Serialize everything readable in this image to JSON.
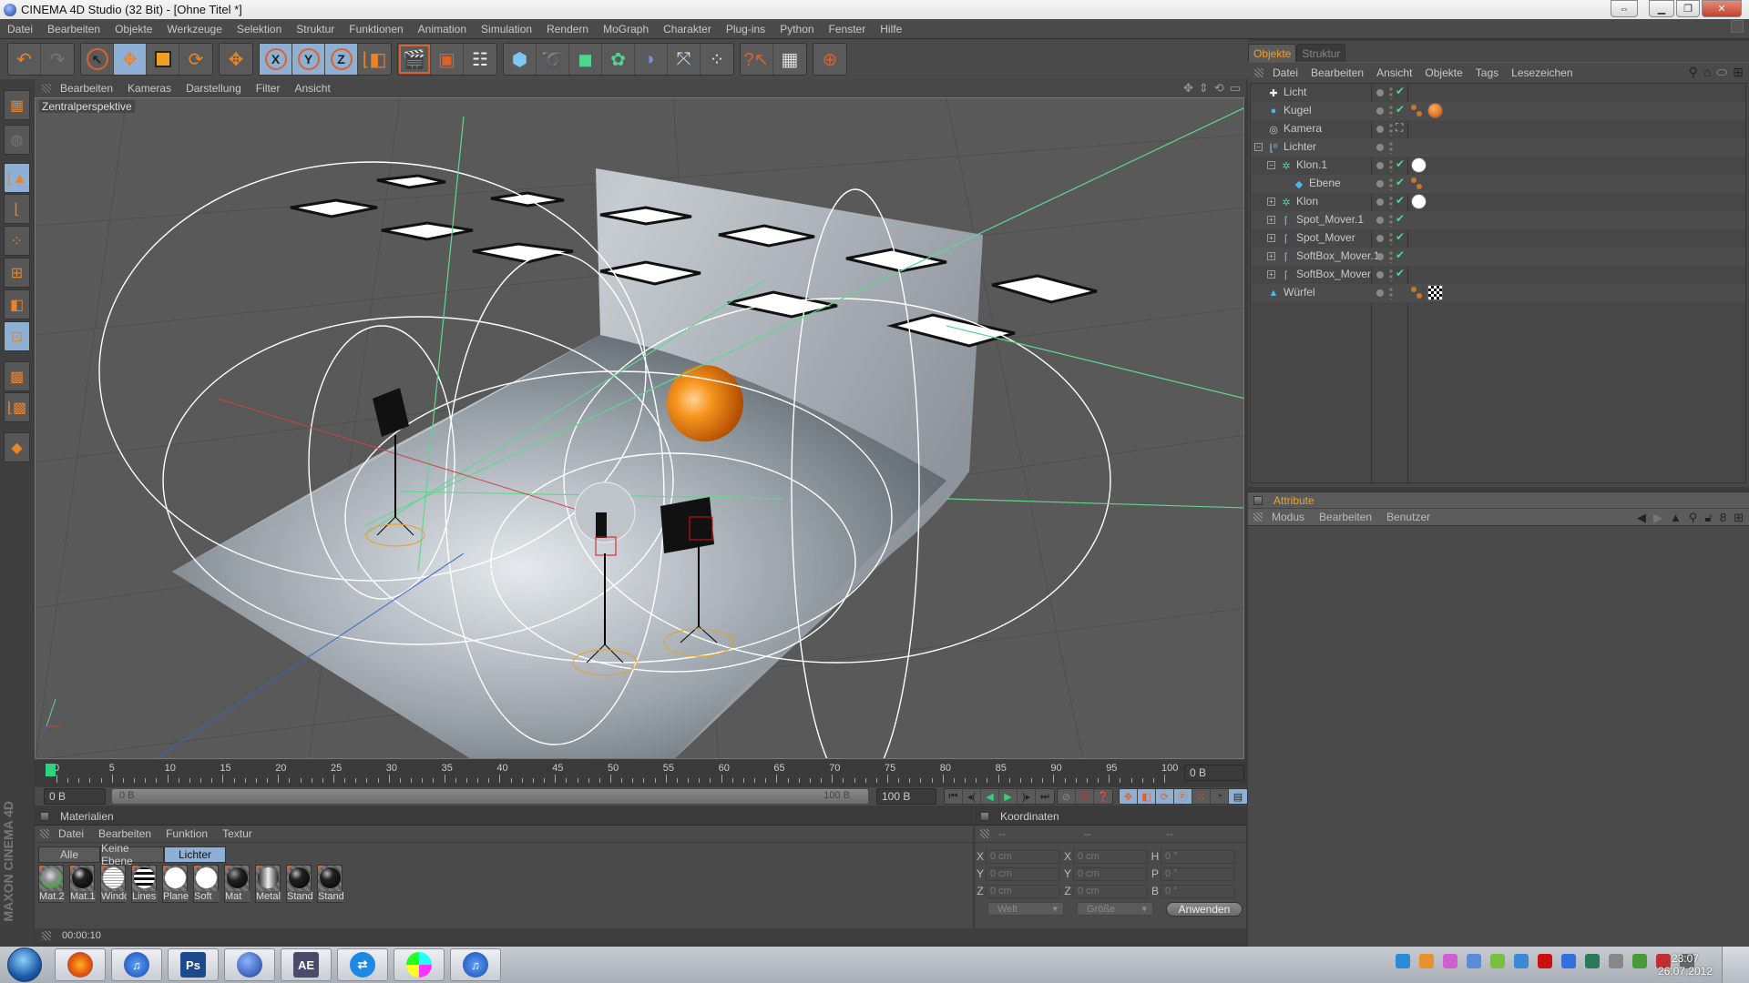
{
  "window": {
    "title": "CINEMA 4D Studio (32 Bit) - [Ohne Titel *]",
    "controls": [
      "resize",
      "minimize",
      "restore",
      "close"
    ]
  },
  "menubar": [
    "Datei",
    "Bearbeiten",
    "Objekte",
    "Werkzeuge",
    "Selektion",
    "Struktur",
    "Funktionen",
    "Animation",
    "Simulation",
    "Rendern",
    "MoGraph",
    "Charakter",
    "Plug-ins",
    "Python",
    "Fenster",
    "Hilfe"
  ],
  "toolbar": {
    "groups": [
      [
        {
          "icon": "undo-icon",
          "active": false
        },
        {
          "icon": "redo-icon",
          "active": false,
          "disabled": true
        }
      ],
      [
        {
          "icon": "live-select-icon",
          "active": false
        },
        {
          "icon": "move-icon",
          "active": true
        },
        {
          "icon": "scale-icon",
          "active": false
        },
        {
          "icon": "rotate-icon",
          "active": false
        }
      ],
      [
        {
          "icon": "last-tool-icon",
          "active": false
        }
      ],
      [
        {
          "icon": "x-axis-lock-icon",
          "label": "X",
          "active": true
        },
        {
          "icon": "y-axis-lock-icon",
          "label": "Y",
          "active": true
        },
        {
          "icon": "z-axis-lock-icon",
          "label": "Z",
          "active": true
        },
        {
          "icon": "coordinate-system-icon",
          "active": false
        }
      ],
      [
        {
          "icon": "render-view-icon",
          "active": false
        },
        {
          "icon": "render-picture-viewer-icon",
          "active": false
        },
        {
          "icon": "render-settings-icon",
          "active": false
        }
      ],
      [
        {
          "icon": "cube-icon"
        },
        {
          "icon": "spline-pen-icon"
        },
        {
          "icon": "subdivision-surface-icon"
        },
        {
          "icon": "array-icon"
        },
        {
          "icon": "deformer-bend-icon"
        },
        {
          "icon": "scene-floor-icon"
        },
        {
          "icon": "particle-emitter-icon"
        }
      ],
      [
        {
          "icon": "help-pointer-icon"
        },
        {
          "icon": "command-manager-icon"
        }
      ],
      [
        {
          "icon": "web-browser-icon"
        }
      ]
    ]
  },
  "left_tools": [
    {
      "icon": "layout-icon",
      "active": false
    },
    {
      "icon": "make-editable-icon",
      "active": false,
      "disabled": true
    },
    {
      "icon": "model-mode-icon",
      "active": true
    },
    {
      "icon": "object-axis-mode-icon",
      "active": false
    },
    {
      "icon": "points-mode-icon",
      "active": false
    },
    {
      "icon": "edges-mode-icon",
      "active": false
    },
    {
      "icon": "polygons-mode-icon",
      "active": false
    },
    {
      "icon": "uv-points-mode-icon",
      "active": true
    },
    {
      "icon": "texture-mode-icon",
      "active": false
    },
    {
      "icon": "texture-axis-mode-icon",
      "active": false
    },
    {
      "icon": "workplane-snap-icon",
      "active": false
    }
  ],
  "branding": "MAXON CINEMA 4D",
  "viewport": {
    "menu": [
      "Bearbeiten",
      "Kameras",
      "Darstellung",
      "Filter",
      "Ansicht"
    ],
    "label": "Zentralperspektive",
    "nav_icons": [
      "pan-icon",
      "dolly-icon",
      "orbit-icon",
      "maximize-view-icon"
    ],
    "colors": {
      "background": "#595959",
      "backdrop": "#b8bec6",
      "sphere": "#f08a20",
      "guides": "#5fd88e",
      "wire": "#ffffff"
    }
  },
  "timeline": {
    "ticks": [
      0,
      5,
      10,
      15,
      20,
      25,
      30,
      35,
      40,
      45,
      50,
      55,
      60,
      65,
      70,
      75,
      80,
      85,
      90,
      95,
      100
    ],
    "current_frame": 0,
    "max_frame": 100,
    "current_frame_field": "0 B"
  },
  "transport": {
    "start_field": "0 B",
    "range_start": "0 B",
    "range_end": "100 B",
    "end_field": "100 B",
    "buttons": [
      "goto-start-icon",
      "prev-key-icon",
      "play-backward-icon",
      "play-forward-icon",
      "next-key-icon",
      "goto-end-icon"
    ],
    "record_buttons": [
      "record-keys-icon",
      "auto-keying-icon",
      "keyframe-selection-icon"
    ],
    "key_buttons": [
      "position-key-icon",
      "scale-key-icon",
      "rotation-key-icon",
      "parameter-key-icon",
      "point-level-anim-icon",
      "scheme-icon",
      "timeline-icon"
    ]
  },
  "materials": {
    "title": "Materialien",
    "menu": [
      "Datei",
      "Bearbeiten",
      "Funktion",
      "Textur"
    ],
    "tabs": [
      {
        "label": "Alle",
        "active": false
      },
      {
        "label": "Keine Ebene",
        "active": false
      },
      {
        "label": "Lichter",
        "active": true
      }
    ],
    "items": [
      {
        "name": "Mat.2",
        "ball": "radial-gradient(circle at 45% 40%,#dde 0,#888 40%,#4a4 70%,#222 100%)"
      },
      {
        "name": "Mat.1",
        "ball": "radial-gradient(circle at 35% 30%,#ddd 0,#222 30%,#000 100%)"
      },
      {
        "name": "Windo",
        "ball": "repeating-linear-gradient(0deg,#fff 0 2px,#aaa 2px 3px)"
      },
      {
        "name": "Lines",
        "ball": "repeating-linear-gradient(0deg,#fff 0 3px,#111 3px 6px)"
      },
      {
        "name": "Plane",
        "ball": "#ffffff"
      },
      {
        "name": "Soft",
        "ball": "#ffffff"
      },
      {
        "name": "Mat",
        "ball": "radial-gradient(circle at 35% 30%,#999 0,#222 35%,#000 100%)"
      },
      {
        "name": "Metal",
        "ball": "linear-gradient(90deg,#222,#eee 50%,#222)"
      },
      {
        "name": "Standard",
        "ball": "radial-gradient(circle at 35% 30%,#bbb 0,#222 30%,#000 100%)"
      },
      {
        "name": "Standard",
        "ball": "radial-gradient(circle at 35% 30%,#bbb 0,#222 30%,#000 100%)"
      }
    ]
  },
  "status_bar": {
    "time": "00:00:10"
  },
  "coordinates": {
    "title": "Koordinaten",
    "headers": [
      "--",
      "--",
      "--"
    ],
    "rows": [
      {
        "pos_label": "X",
        "pos": "0 cm",
        "size_label": "X",
        "size": "0 cm",
        "rot_label": "H",
        "rot": "0 °"
      },
      {
        "pos_label": "Y",
        "pos": "0 cm",
        "size_label": "Y",
        "size": "0 cm",
        "rot_label": "P",
        "rot": "0 °"
      },
      {
        "pos_label": "Z",
        "pos": "0 cm",
        "size_label": "Z",
        "size": "0 cm",
        "rot_label": "B",
        "rot": "0 °"
      }
    ],
    "mode_dropdown": "Welt",
    "size_dropdown": "Größe",
    "apply_label": "Anwenden"
  },
  "objects_panel": {
    "tabs": [
      {
        "label": "Objekte",
        "active": true
      },
      {
        "label": "Struktur",
        "active": false
      }
    ],
    "menu": [
      "Datei",
      "Bearbeiten",
      "Ansicht",
      "Objekte",
      "Tags",
      "Lesezeichen"
    ],
    "tool_icons": [
      "search-icon",
      "home-icon",
      "view-icon",
      "new-panel-icon"
    ],
    "objects": [
      {
        "name": "Licht",
        "icon": "light-icon",
        "depth": 0,
        "expand": "none",
        "enabled": true,
        "tags": []
      },
      {
        "name": "Kugel",
        "icon": "sphere-icon",
        "depth": 0,
        "expand": "none",
        "enabled": true,
        "tags": [
          "phong-tag",
          "material-orange"
        ]
      },
      {
        "name": "Kamera",
        "icon": "camera-icon",
        "depth": 0,
        "expand": "none",
        "enabled": "target",
        "tags": []
      },
      {
        "name": "Lichter",
        "icon": "null-icon",
        "depth": 0,
        "expand": "minus",
        "enabled": null,
        "tags": []
      },
      {
        "name": "Klon.1",
        "icon": "cloner-icon",
        "depth": 1,
        "expand": "minus",
        "enabled": true,
        "tags": [
          "material-white"
        ]
      },
      {
        "name": "Ebene",
        "icon": "plane-icon",
        "depth": 2,
        "expand": "none",
        "enabled": true,
        "tags": [
          "phong-tag"
        ]
      },
      {
        "name": "Klon",
        "icon": "cloner-icon",
        "depth": 1,
        "expand": "plus",
        "enabled": true,
        "tags": [
          "material-white"
        ]
      },
      {
        "name": "Spot_Mover.1",
        "icon": "spline-icon",
        "depth": 1,
        "expand": "plus",
        "enabled": true,
        "tags": []
      },
      {
        "name": "Spot_Mover",
        "icon": "spline-icon",
        "depth": 1,
        "expand": "plus",
        "enabled": true,
        "tags": []
      },
      {
        "name": "SoftBox_Mover.1",
        "icon": "spline-icon",
        "depth": 1,
        "expand": "plus",
        "enabled": true,
        "tags": []
      },
      {
        "name": "SoftBox_Mover",
        "icon": "spline-icon",
        "depth": 1,
        "expand": "plus",
        "enabled": true,
        "tags": []
      },
      {
        "name": "Würfel",
        "icon": "deformer-icon",
        "depth": 0,
        "expand": "none",
        "enabled": null,
        "tags": [
          "phong-tag",
          "material-checker"
        ]
      }
    ]
  },
  "attributes_panel": {
    "title": "Attribute",
    "menu": [
      "Modus",
      "Bearbeiten",
      "Benutzer"
    ],
    "tool_icons": [
      "back-icon",
      "forward-icon",
      "up-icon",
      "search-icon",
      "lock-icon",
      "link-icon",
      "new-panel-icon"
    ]
  },
  "taskbar": {
    "apps": [
      {
        "name": "firefox",
        "label": "",
        "color": "radial-gradient(circle,#ffb020,#e05010 60%,#2a5aa8)"
      },
      {
        "name": "itunes",
        "label": "♫",
        "color": "radial-gradient(circle,#5aa0ff,#1a4aa8)"
      },
      {
        "name": "photoshop",
        "label": "Ps",
        "color": "#1c4a8c"
      },
      {
        "name": "cinema4d",
        "label": "",
        "color": "radial-gradient(circle at 40% 35%,#8ab4ff,#1a3a9a)"
      },
      {
        "name": "after-effects",
        "label": "AE",
        "color": "#4a4a6a"
      },
      {
        "name": "teamviewer",
        "label": "⇄",
        "color": "#1e88e5"
      },
      {
        "name": "color-app",
        "label": "",
        "color": "conic-gradient(#2ff 0 25%,#f3f 0 50%,#ff2 0 75%,#2f2 0)"
      },
      {
        "name": "itunes-2",
        "label": "♫",
        "color": "radial-gradient(circle,#5aa0ff,#1a4aa8)"
      }
    ],
    "tray_icons": [
      "teamviewer-tray-icon",
      "warning-tray-icon",
      "color-tray-icon",
      "network-tray-icon",
      "nvidia-tray-icon",
      "update-tray-icon",
      "adobe-tray-icon",
      "flash-tray-icon",
      "bluetooth-tray-icon",
      "volume-tray-icon",
      "usb-tray-icon",
      "action-center-tray-icon",
      "network-status-icon"
    ],
    "time": "23:07",
    "date": "26.07.2012"
  }
}
